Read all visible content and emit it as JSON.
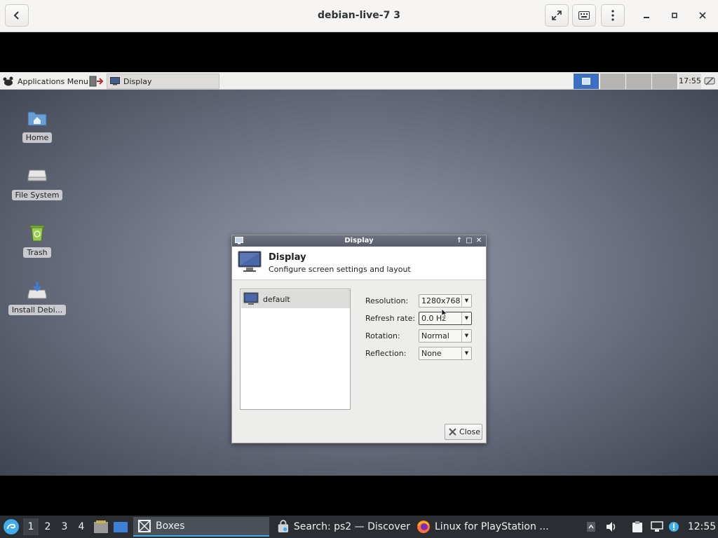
{
  "boxes": {
    "title": "debian-live-7 3"
  },
  "xfce_panel": {
    "app_menu_label": "Applications Menu",
    "task_label": "Display",
    "clock": "17:55"
  },
  "desktop": {
    "icons": [
      {
        "label": "Home"
      },
      {
        "label": "File System"
      },
      {
        "label": "Trash"
      },
      {
        "label": "Install Debi..."
      }
    ]
  },
  "dialog": {
    "window_title": "Display",
    "heading": "Display",
    "subheading": "Configure screen settings and layout",
    "outputs": [
      "default"
    ],
    "fields": {
      "resolution": {
        "label": "Resolution:",
        "value": "1280x768"
      },
      "refresh_rate": {
        "label": "Refresh rate:",
        "value": "0.0 Hz"
      },
      "rotation": {
        "label": "Rotation:",
        "value": "Normal"
      },
      "reflection": {
        "label": "Reflection:",
        "value": "None"
      }
    },
    "close_label": "Close"
  },
  "host_taskbar": {
    "workspaces": [
      "1",
      "2",
      "3",
      "4"
    ],
    "tasks": [
      {
        "label": "Boxes"
      },
      {
        "label": "Search: ps2 — Discover"
      },
      {
        "label": "Linux for PlayStation ..."
      }
    ],
    "clock": "12:55"
  },
  "colors": {
    "accent": "#3daee9",
    "xfce_workspace_active": "#3b6fc2",
    "taskbar_bg": "#2a2e32"
  }
}
